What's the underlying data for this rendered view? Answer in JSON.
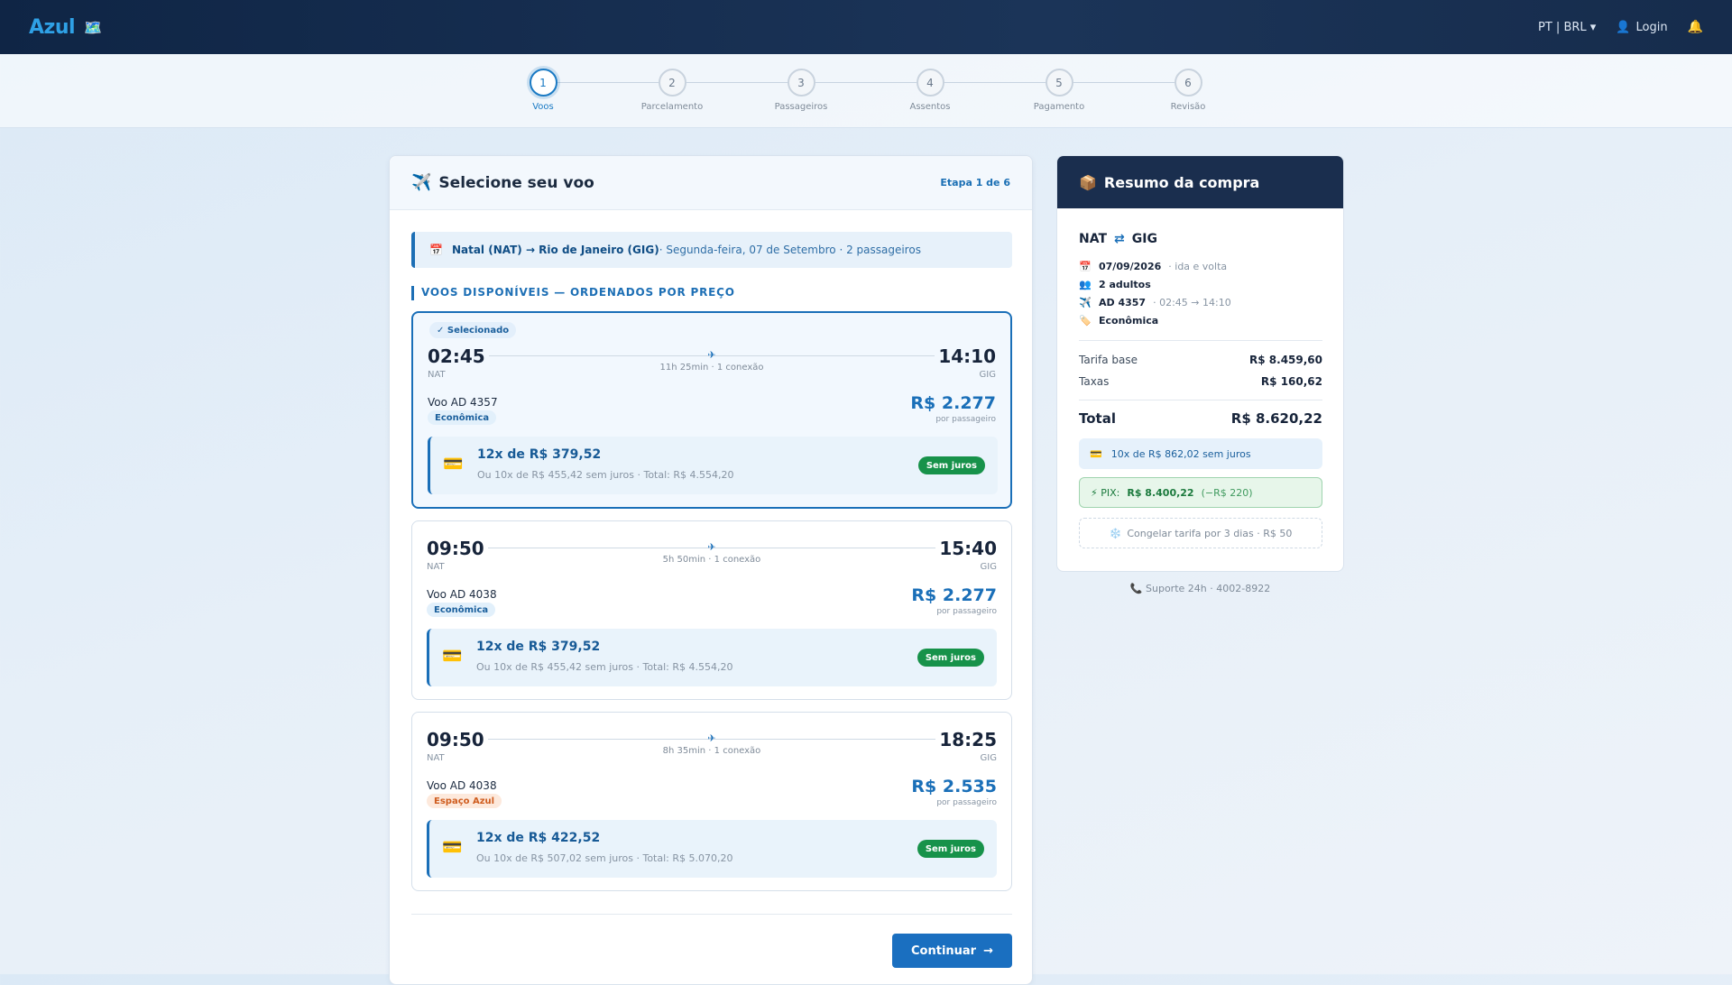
{
  "header": {
    "logo": "Azul",
    "flag_icon": "map-flag-icon",
    "lang": "PT | BRL ▾",
    "login": "Login"
  },
  "steps": [
    {
      "num": "1",
      "label": "Voos",
      "active": true
    },
    {
      "num": "2",
      "label": "Parcelamento",
      "active": false
    },
    {
      "num": "3",
      "label": "Passageiros",
      "active": false
    },
    {
      "num": "4",
      "label": "Assentos",
      "active": false
    },
    {
      "num": "5",
      "label": "Pagamento",
      "active": false
    },
    {
      "num": "6",
      "label": "Revisão",
      "active": false
    }
  ],
  "main": {
    "title": "Selecione seu voo",
    "step_count": "Etapa 1 de 6",
    "route": "Natal (NAT) → Rio de Janeiro (GIG)",
    "route_rest": " · Segunda-feira, 07 de Setembro · 2 passageiros",
    "section_title": "VOOS DISPONÍVEIS — ORDENADOS POR PREÇO",
    "continue": "Continuar",
    "continue_arrow": "→"
  },
  "flights": [
    {
      "selected_label": "✓ Selecionado",
      "dep_time": "02:45",
      "dep_code": "NAT",
      "arr_time": "14:10",
      "arr_code": "GIG",
      "duration": "11h 25min · 1 conexão",
      "flight_no": "Voo AD 4357",
      "cabin": "Econômica",
      "price": "R$ 2.277",
      "per_pax": "por passageiro",
      "inst_main": "12x de R$ 379,52",
      "inst_sub": "Ou 10x de R$ 455,42 sem juros · Total: R$ 4.554,20",
      "badge": "Sem juros"
    },
    {
      "dep_time": "09:50",
      "dep_code": "NAT",
      "arr_time": "15:40",
      "arr_code": "GIG",
      "duration": "5h 50min · 1 conexão",
      "flight_no": "Voo AD 4038",
      "cabin": "Econômica",
      "price": "R$ 2.277",
      "per_pax": "por passageiro",
      "inst_main": "12x de R$ 379,52",
      "inst_sub": "Ou 10x de R$ 455,42 sem juros · Total: R$ 4.554,20",
      "badge": "Sem juros"
    },
    {
      "dep_time": "09:50",
      "dep_code": "NAT",
      "arr_time": "18:25",
      "arr_code": "GIG",
      "duration": "8h 35min · 1 conexão",
      "flight_no": "Voo AD 4038",
      "cabin": "Espaço Azul",
      "price": "R$ 2.535",
      "per_pax": "por passageiro",
      "inst_main": "12x de R$ 422,52",
      "inst_sub": "Ou 10x de R$ 507,02 sem juros · Total: R$ 5.070,20",
      "badge": "Sem juros"
    }
  ],
  "summary": {
    "title": "Resumo da compra",
    "origin": "NAT",
    "swap": "⇄",
    "destination": "GIG",
    "date": "07/09/2026",
    "trip_type": "· ida e volta",
    "passengers": "2 adultos",
    "flight": "AD 4357",
    "flight_times": "· 02:45 → 14:10",
    "cabin": "Econômica",
    "base_label": "Tarifa base",
    "base_value": "R$ 8.459,60",
    "tax_label": "Taxas",
    "tax_value": "R$ 160,62",
    "total_label": "Total",
    "total_value": "R$ 8.620,22",
    "installments": "10x de R$ 862,02 sem juros",
    "pix_label": "⚡ PIX:",
    "pix_value": "R$ 8.400,22",
    "pix_discount": "(−R$ 220)",
    "freeze": "Congelar tarifa por 3 dias · R$ 50"
  },
  "support": "📞 Suporte 24h · 4002-8922",
  "colors": {
    "brand": "#1a6fb8",
    "nav": "#0f2545",
    "success": "#17924a"
  }
}
